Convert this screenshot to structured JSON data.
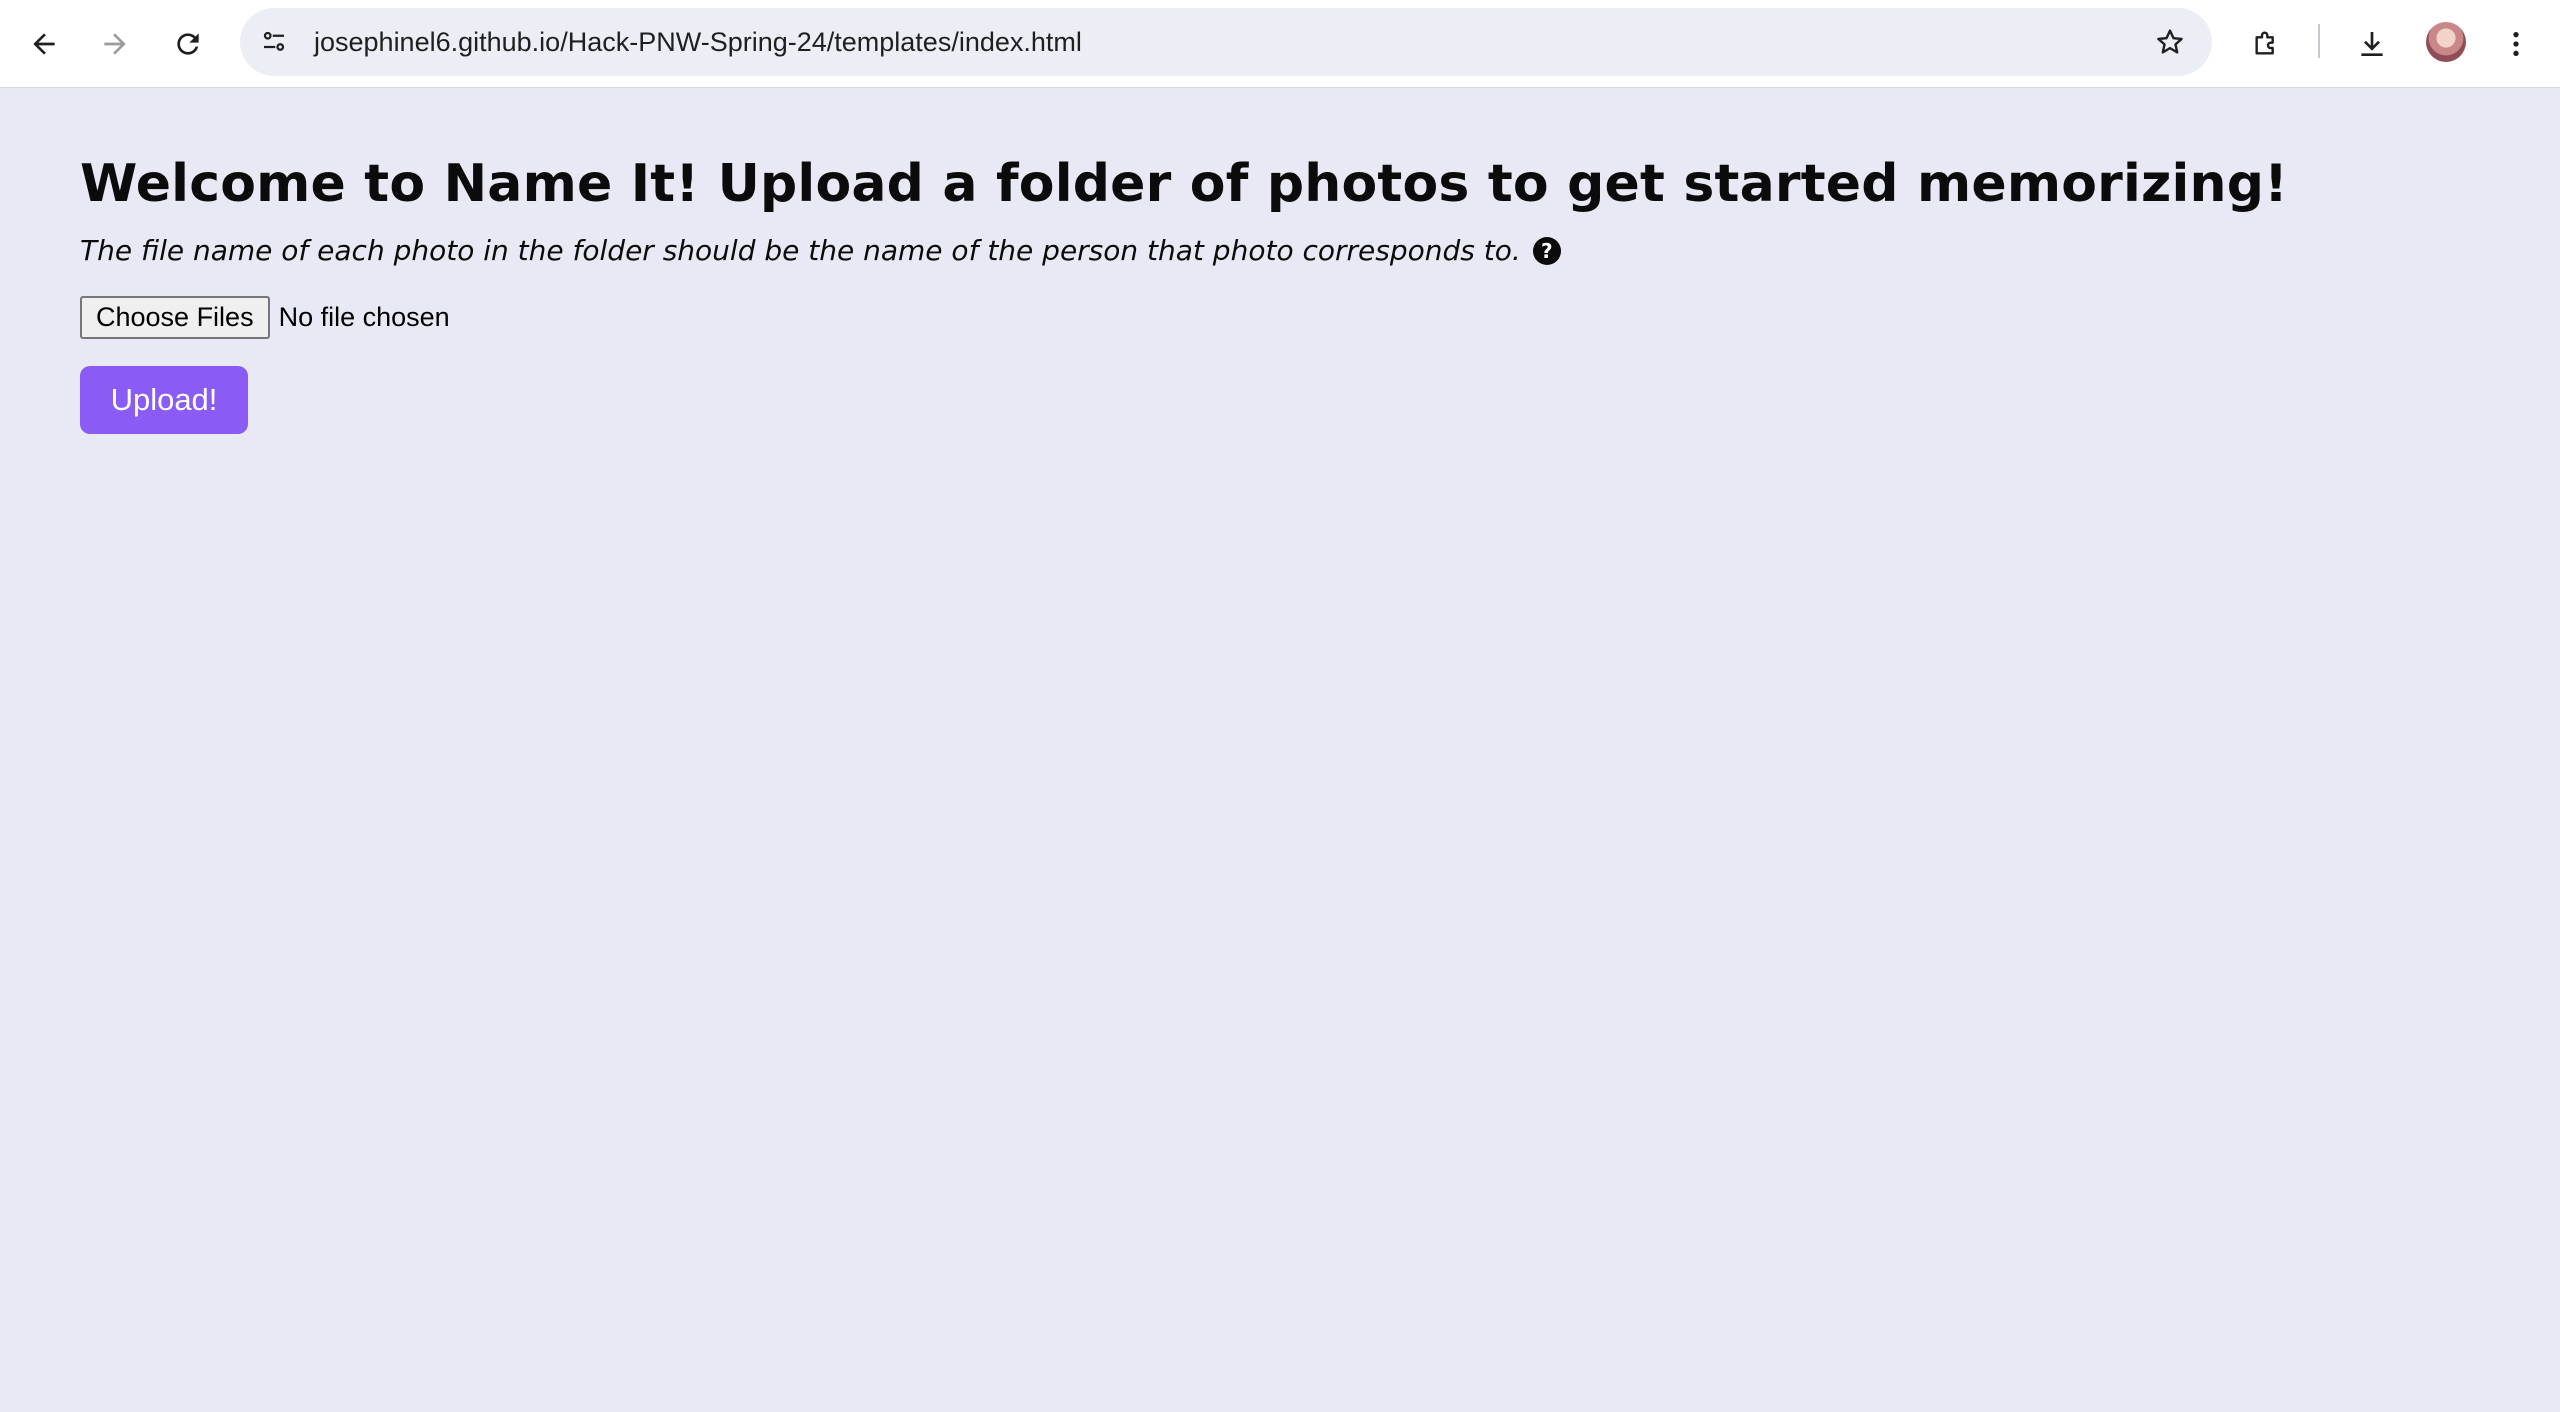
{
  "browser": {
    "url": "josephinel6.github.io/Hack-PNW-Spring-24/templates/index.html",
    "icons": [
      "back-icon",
      "forward-icon",
      "reload-icon",
      "site-info-icon",
      "bookmark-star-icon",
      "extensions-icon",
      "download-icon",
      "profile-avatar",
      "more-menu-icon"
    ]
  },
  "page": {
    "title": "Welcome to Name It! Upload a folder of photos to get started memorizing!",
    "subtitle": "The file name of each photo in the folder should be the name of the person that photo corresponds to.",
    "help_glyph": "?",
    "file_input": {
      "button_label": "Choose Files",
      "status": "No file chosen"
    },
    "upload_label": "Upload!"
  },
  "colors": {
    "page_background": "#e8e9f4",
    "accent": "#8a5cf5",
    "text": "#0b0b0b"
  }
}
